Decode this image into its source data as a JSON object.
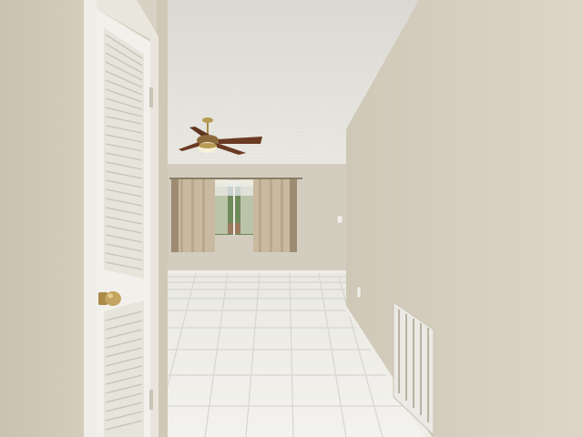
{
  "scene": {
    "type": "interior-hallway-photo",
    "colors": {
      "wall_left": "#cfc8b6",
      "wall_right": "#d6cfbf",
      "back_wall": "#d3cdbf",
      "ceiling": "#e6e4de",
      "floor_tile": "#ecebe6",
      "grout": "#d7d5cf",
      "door": "#f2f0ea",
      "trim": "#efede7",
      "knob": "#b89a55",
      "curtain": "#c9b9a0",
      "window_green": "#6f8a5a",
      "fan_blade": "#6b3a22"
    },
    "icons": [
      "ceiling-fan-icon",
      "door-knob-icon",
      "air-vent-icon",
      "window-icon"
    ]
  }
}
